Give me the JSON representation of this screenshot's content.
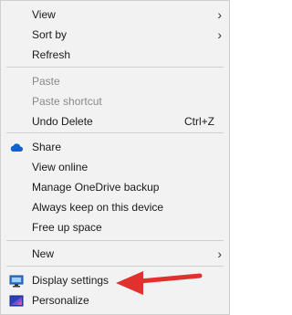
{
  "menu": {
    "view": "View",
    "sort_by": "Sort by",
    "refresh": "Refresh",
    "paste": "Paste",
    "paste_shortcut": "Paste shortcut",
    "undo_delete": "Undo Delete",
    "undo_shortcut": "Ctrl+Z",
    "share": "Share",
    "view_online": "View online",
    "manage_onedrive_backup": "Manage OneDrive backup",
    "always_keep": "Always keep on this device",
    "free_up_space": "Free up space",
    "new": "New",
    "display_settings": "Display settings",
    "personalize": "Personalize"
  },
  "icons": {
    "share": "cloud-icon",
    "display_settings": "monitor-icon",
    "personalize": "personalize-icon",
    "submenu": "chevron-right-icon",
    "annotation": "red-arrow"
  },
  "colors": {
    "menu_bg": "#f2f2f2",
    "text": "#1a1a1a",
    "disabled_text": "#8a8a8a",
    "separator": "#cfcfcf",
    "onedrive_blue": "#0a64d6",
    "arrow_red": "#e0312f"
  }
}
